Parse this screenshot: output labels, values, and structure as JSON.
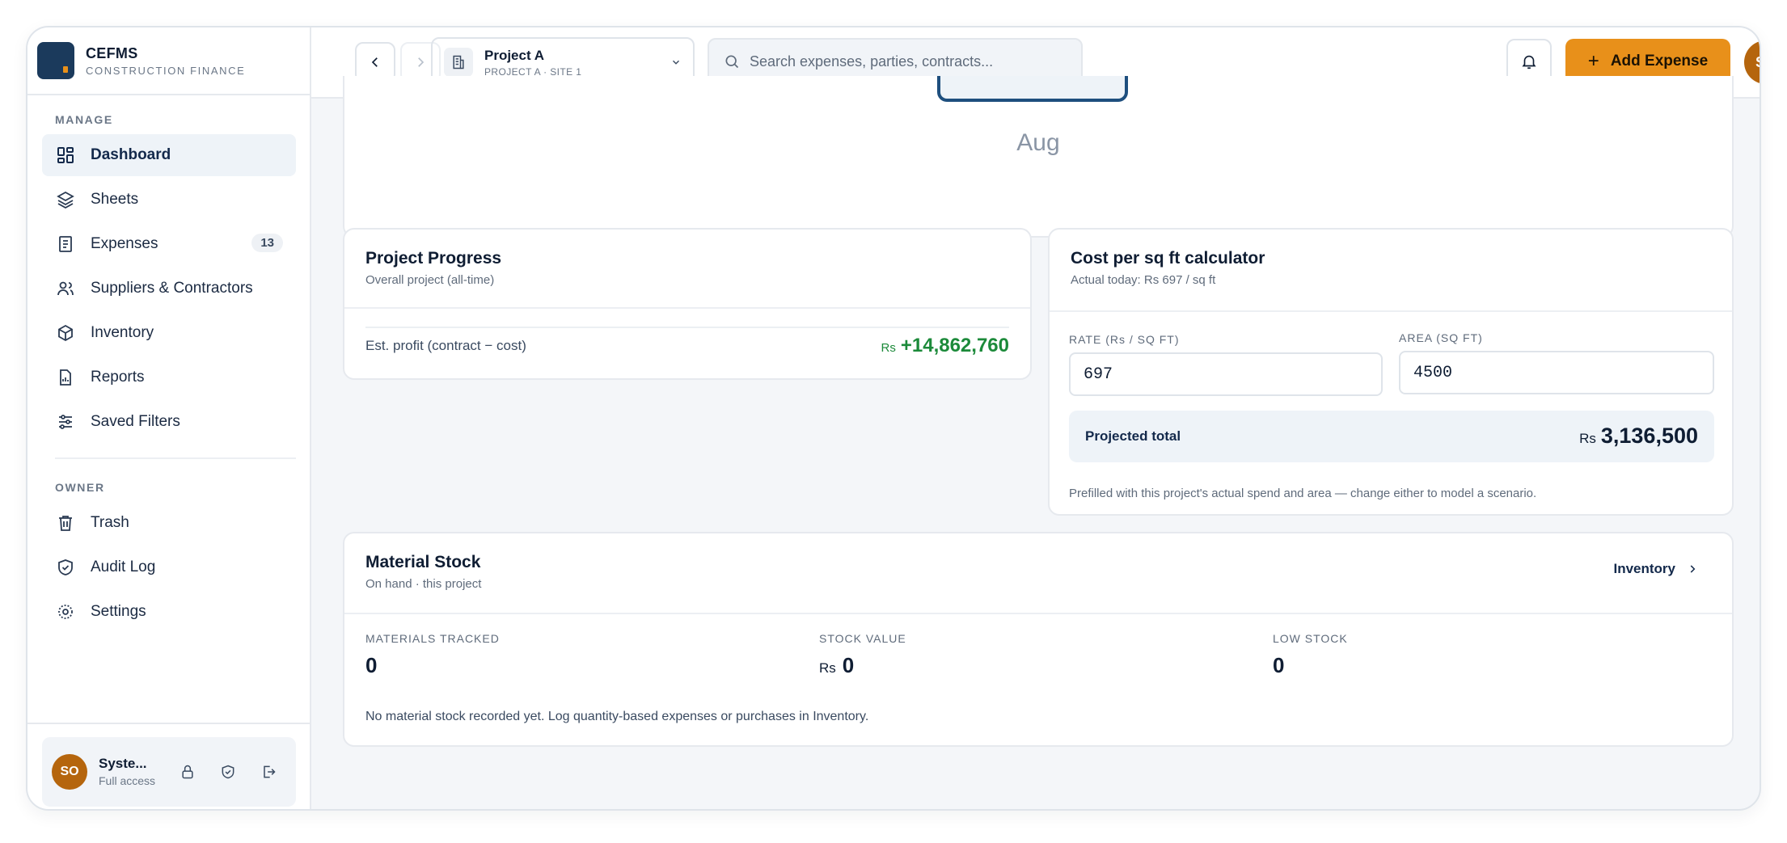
{
  "brand": {
    "name": "CEFMS",
    "subtitle": "CONSTRUCTION FINANCE"
  },
  "sidebar": {
    "manage_label": "MANAGE",
    "owner_label": "OWNER",
    "manage_items": [
      {
        "label": "Dashboard",
        "icon": "dashboard-icon",
        "active": true
      },
      {
        "label": "Sheets",
        "icon": "layers-icon"
      },
      {
        "label": "Expenses",
        "icon": "receipt-icon",
        "badge": "13"
      },
      {
        "label": "Suppliers & Contractors",
        "icon": "users-icon"
      },
      {
        "label": "Inventory",
        "icon": "box-icon"
      },
      {
        "label": "Reports",
        "icon": "report-icon"
      },
      {
        "label": "Saved Filters",
        "icon": "sliders-icon"
      }
    ],
    "owner_items": [
      {
        "label": "Trash",
        "icon": "trash-icon"
      },
      {
        "label": "Audit Log",
        "icon": "shield-check-icon"
      },
      {
        "label": "Settings",
        "icon": "gear-icon"
      }
    ],
    "user": {
      "initials": "SO",
      "name": "Syste...",
      "role": "Full access"
    }
  },
  "topbar": {
    "project_name": "Project A",
    "project_sub": "PROJECT A · SITE 1",
    "search_placeholder": "Search expenses, parties, contracts...",
    "add_expense_label": "Add Expense",
    "avatar_initials": "SO"
  },
  "chart": {
    "month": "Aug"
  },
  "progress": {
    "title": "Project Progress",
    "subtitle": "Overall project (all-time)",
    "profit_label": "Est. profit (contract − cost)",
    "profit_currency": "Rs",
    "profit_value": "+14,862,760"
  },
  "calculator": {
    "title": "Cost per sq ft calculator",
    "subtitle": "Actual today: Rs 697 / sq ft",
    "rate_label": "RATE (Rs / SQ FT)",
    "rate_value": "697",
    "area_label": "AREA (SQ FT)",
    "area_value": "4500",
    "total_label": "Projected total",
    "total_currency": "Rs",
    "total_value": "3,136,500",
    "note": "Prefilled with this project's actual spend and area — change either to model a scenario."
  },
  "stock": {
    "title": "Material Stock",
    "subtitle": "On hand · this project",
    "inventory_link": "Inventory",
    "materials_label": "MATERIALS TRACKED",
    "materials_value": "0",
    "stock_value_label": "STOCK VALUE",
    "stock_value_currency": "Rs",
    "stock_value": "0",
    "low_stock_label": "LOW STOCK",
    "low_stock_value": "0",
    "note": "No material stock recorded yet. Log quantity-based expenses or purchases in Inventory."
  },
  "colors": {
    "accent": "#e8901a",
    "brand": "#1b3a5c",
    "positive": "#1c8a3a",
    "avatar": "#b5650d"
  }
}
